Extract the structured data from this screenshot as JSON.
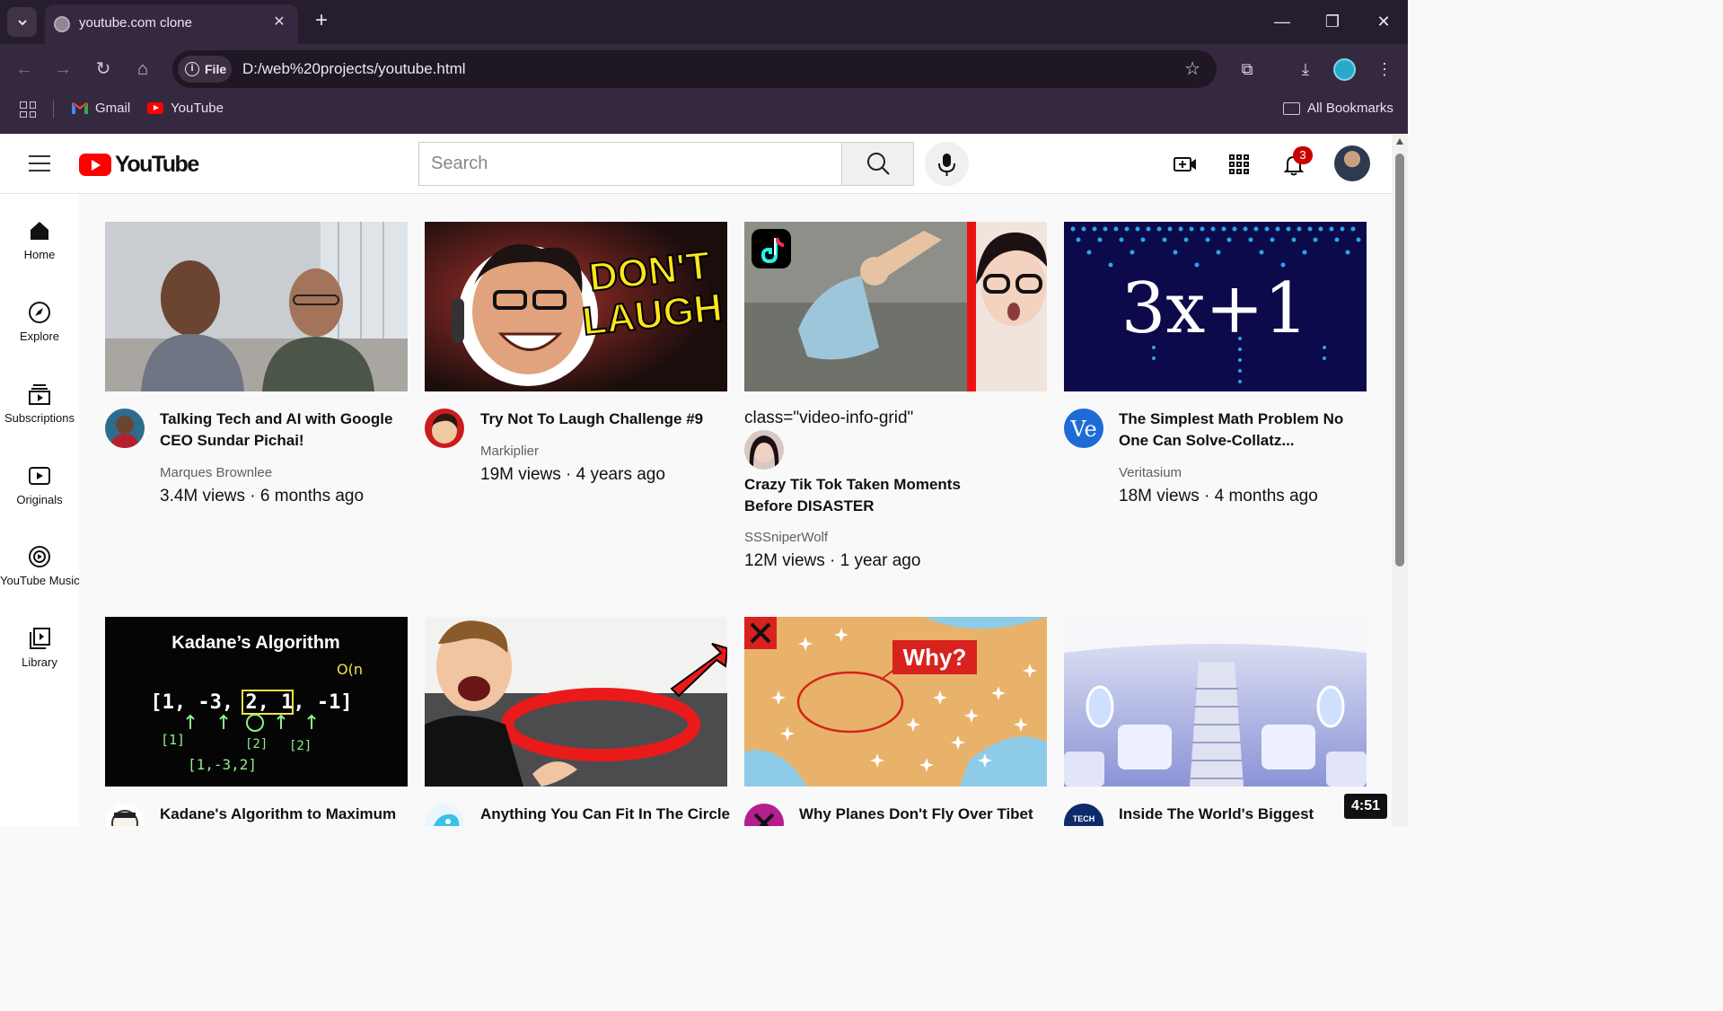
{
  "browser": {
    "tab_title": "youtube.com clone",
    "site_chip": "File",
    "url": "D:/web%20projects/youtube.html",
    "bookmarks": [
      "Gmail",
      "YouTube"
    ],
    "all_bookmarks": "All Bookmarks"
  },
  "header": {
    "logo_text": "YouTube",
    "search_placeholder": "Search",
    "notification_count": "3"
  },
  "sidebar": {
    "items": [
      {
        "label": "Home",
        "icon": "home-icon"
      },
      {
        "label": "Explore",
        "icon": "explore-icon"
      },
      {
        "label": "Subscriptions",
        "icon": "subscriptions-icon"
      },
      {
        "label": "Originals",
        "icon": "originals-icon"
      },
      {
        "label": "YouTube Music",
        "icon": "music-icon"
      },
      {
        "label": "Library",
        "icon": "library-icon"
      }
    ]
  },
  "videos": [
    {
      "title": "Talking Tech and AI with Google CEO Sundar Pichai!",
      "channel": "Marques Brownlee",
      "stats": "3.4M views · 6 months ago"
    },
    {
      "title": "Try Not To Laugh Challenge #9",
      "channel": "Markiplier",
      "stats": "19M views · 4 years ago"
    },
    {
      "title": "Crazy Tik Tok Taken Moments Before DISASTER",
      "channel": "SSSniperWolf",
      "stats": "12M views · 1 year ago",
      "stray_text": "class=\"video-info-grid\""
    },
    {
      "title": "The Simplest Math Problem No One Can Solve-Collatz...",
      "channel": "Veritasium",
      "stats": "18M views · 4 months ago"
    },
    {
      "title": "Kadane's Algorithm to Maximum",
      "channel": "",
      "stats": ""
    },
    {
      "title": "Anything You Can Fit In The Circle",
      "channel": "",
      "stats": ""
    },
    {
      "title": "Why Planes Don't Fly Over Tibet",
      "channel": "",
      "stats": ""
    },
    {
      "title": "Inside The World's Biggest",
      "channel": "",
      "stats": ""
    }
  ],
  "thumb_text": {
    "dont_laugh_1": "DON'T",
    "dont_laugh_2": "LAUGH",
    "collatz": "3x+1",
    "kadane_title": "Kadane’s Algorithm",
    "kadane_on": "O(n",
    "kadane_array": "[1, -3, 2, 1, -1]",
    "kadane_left": "[1]",
    "kadane_mid": "[2]",
    "kadane_right": "[2]",
    "kadane_bottom": "[1,-3,2]",
    "why": "Why?",
    "tech_badge": "TECH"
  },
  "duration": "4:51"
}
